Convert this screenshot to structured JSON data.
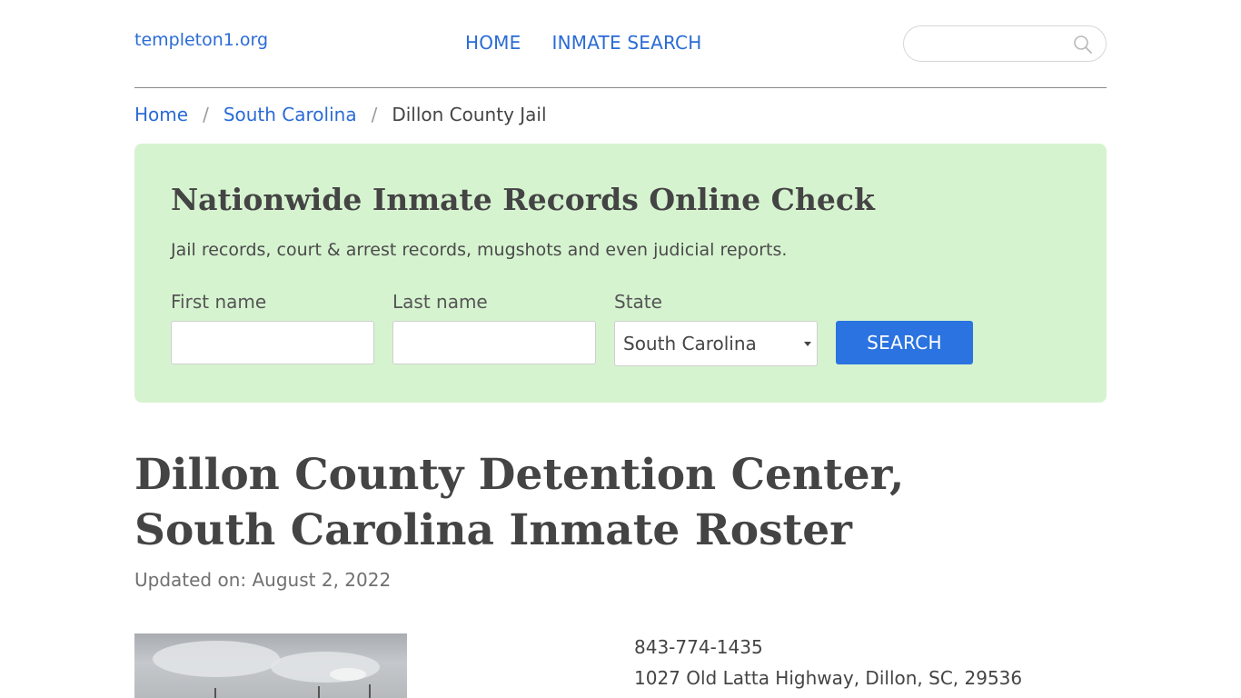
{
  "header": {
    "logo": "templeton1.org",
    "nav": [
      {
        "label": "HOME"
      },
      {
        "label": "INMATE SEARCH"
      }
    ],
    "search_placeholder": ""
  },
  "breadcrumb": {
    "items": [
      "Home",
      "South Carolina"
    ],
    "current": "Dillon County Jail",
    "separator": "/"
  },
  "panel": {
    "title": "Nationwide Inmate Records Online Check",
    "subtitle": "Jail records, court & arrest records, mugshots and even judicial reports.",
    "first_name_label": "First name",
    "first_name_value": "",
    "last_name_label": "Last name",
    "last_name_value": "",
    "state_label": "State",
    "state_value": "South Carolina",
    "search_button": "SEARCH",
    "background_color": "#d6f3d0",
    "button_color": "#2a73e0"
  },
  "page": {
    "title": "Dillon County Detention Center, South Carolina Inmate Roster",
    "updated": "Updated on: August 2, 2022"
  },
  "facility": {
    "phone": "843-774-1435",
    "address": "1027 Old Latta Highway, Dillon, SC, 29536"
  },
  "colors": {
    "link": "#2a6bd6",
    "text": "#444444"
  },
  "icons": {
    "search": "search-icon",
    "select_caret": "caret-down-icon"
  }
}
